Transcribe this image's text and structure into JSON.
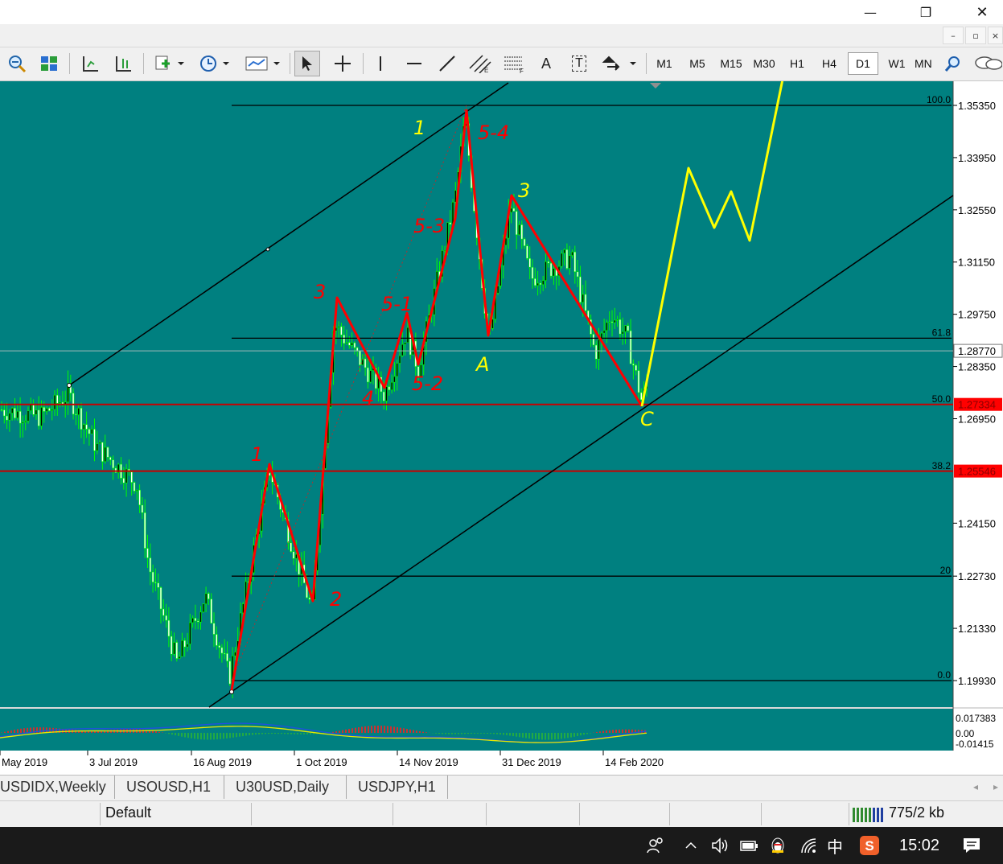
{
  "window": {
    "minimize_glyph": "—",
    "restore_glyph": "❐",
    "close_glyph": "✕",
    "mdi_minimize": "–",
    "mdi_restore": "▫",
    "mdi_close": "×"
  },
  "toolbar": {
    "text_tool": "A",
    "label_tool": "T",
    "timeframes": [
      "M1",
      "M5",
      "M15",
      "M30",
      "H1",
      "H4",
      "D1",
      "W1",
      "MN"
    ],
    "active_timeframe": "D1"
  },
  "colors": {
    "chart_background": "#008080",
    "candles": "#00ff00",
    "drawing_red": "#ff0000",
    "drawing_yellow": "#ffff00",
    "level_line_red": "#c80000",
    "label_red_bg": "#ff0000"
  },
  "chart_data": {
    "type": "candlestick",
    "symbol_timeframe": "D1",
    "y_axis_ticks": [
      "1.35350",
      "1.33950",
      "1.32550",
      "1.31150",
      "1.29750",
      "1.28350",
      "1.26950",
      "1.24150",
      "1.22730",
      "1.21330",
      "1.19930"
    ],
    "current_price": "1.28770",
    "price_labels_red": [
      "1.27334",
      "1.25546"
    ],
    "x_axis_ticks": [
      "May 2019",
      "3 Jul 2019",
      "16 Aug 2019",
      "1 Oct 2019",
      "14 Nov 2019",
      "31 Dec 2019",
      "14 Feb 2020"
    ],
    "fibonacci_levels": [
      {
        "label": "100.0",
        "price": 1.3535
      },
      {
        "label": "61.8",
        "price": 1.2911
      },
      {
        "label": "50.0",
        "price": 1.2733
      },
      {
        "label": "38.2",
        "price": 1.2554
      },
      {
        "label": "20",
        "price": 1.2273
      },
      {
        "label": "0.0",
        "price": 1.1993
      }
    ],
    "handwritten_labels": {
      "red": [
        "1",
        "2",
        "3",
        "4",
        "5-1",
        "5-2",
        "5-3",
        "5-4"
      ],
      "yellow": [
        "1",
        "3",
        "A",
        "C"
      ]
    },
    "indicator_ticks": [
      "0.017383",
      "0.00",
      "-0.01415"
    ]
  },
  "tabs": [
    "USDIDX,Weekly",
    "USOUSD,H1",
    "U30USD,Daily",
    "USDJPY,H1"
  ],
  "tab_scroll": {
    "left": "◂",
    "right": "▸"
  },
  "status": {
    "profile": "Default",
    "traffic": "775/2 kb"
  },
  "taskbar": {
    "ime": "中",
    "clock": "15:02"
  }
}
